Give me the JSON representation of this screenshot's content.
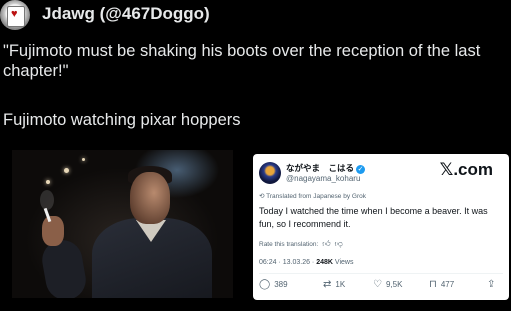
{
  "post": {
    "author": "Jdawg (@467Doggo)",
    "quote": "\"Fujimoto must be shaking his boots over the reception of the last chapter!\"",
    "caption": "Fujimoto watching pixar hoppers"
  },
  "embedded_tweet": {
    "name": "ながやま　こはる",
    "handle": "@nagayama_koharu",
    "logo": "𝕏.com",
    "translated_note": "Translated from Japanese by Grok",
    "text": "Today I watched the time when I become a beaver. It was fun, so I recommend it.",
    "rate_label": "Rate this translation:",
    "time": "06:24 · 13.03.26 ·",
    "views_count": "248K",
    "views_label": "Views",
    "actions": {
      "replies": "389",
      "reposts": "1K",
      "likes": "9,5K",
      "bookmarks": "477"
    },
    "icons": {
      "reply": "reply-icon",
      "repost": "repost-icon",
      "like": "heart-icon",
      "bookmark": "bookmark-icon",
      "share": "share-icon"
    }
  },
  "colors": {
    "background": "#000000",
    "text": "#e7e9ea",
    "verified": "#1d9bf0"
  }
}
